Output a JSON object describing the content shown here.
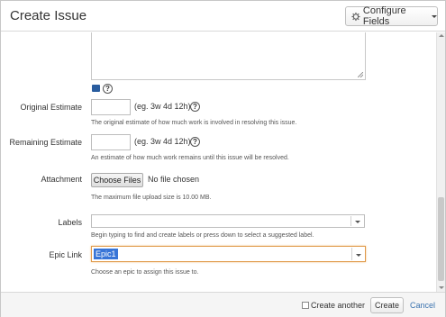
{
  "header": {
    "title": "Create Issue",
    "configure_label": "Configure Fields"
  },
  "form": {
    "original_estimate": {
      "label": "Original Estimate",
      "value": "",
      "example": "(eg. 3w 4d 12h)",
      "hint": "The original estimate of how much work is involved in resolving this issue."
    },
    "remaining_estimate": {
      "label": "Remaining Estimate",
      "value": "",
      "example": "(eg. 3w 4d 12h)",
      "hint": "An estimate of how much work remains until this issue will be resolved."
    },
    "attachment": {
      "label": "Attachment",
      "button": "Choose Files",
      "status": "No file chosen",
      "hint": "The maximum file upload size is 10.00 MB."
    },
    "labels": {
      "label": "Labels",
      "value": "",
      "hint": "Begin typing to find and create labels or press down to select a suggested label."
    },
    "epic_link": {
      "label": "Epic Link",
      "value": "Epic1",
      "hint": "Choose an epic to assign this issue to."
    }
  },
  "footer": {
    "create_another": "Create another",
    "create_another_checked": false,
    "create_label": "Create",
    "cancel_label": "Cancel"
  },
  "icons": {
    "configure": "gear-icon",
    "help": "question-circle-icon",
    "wiki": "wiki-markup-icon",
    "dropdown": "chevron-down-icon"
  },
  "colors": {
    "accent_link": "#3b73af",
    "focus_border": "#e09a4a",
    "selection": "#3875d7"
  }
}
